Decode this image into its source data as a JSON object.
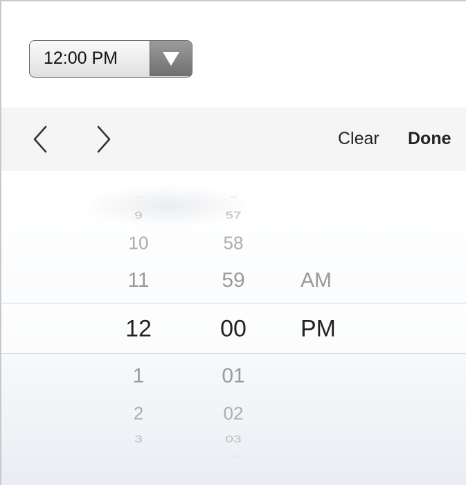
{
  "time_select": {
    "value": "12:00 PM"
  },
  "toolbar": {
    "clear_label": "Clear",
    "done_label": "Done",
    "prev_icon": "chevron-left-icon",
    "next_icon": "chevron-right-icon"
  },
  "picker": {
    "hours": {
      "above": [
        "8",
        "9",
        "10",
        "11"
      ],
      "selected": "12",
      "below": [
        "1",
        "2",
        "3",
        "4"
      ]
    },
    "minutes": {
      "above": [
        "56",
        "57",
        "58",
        "59"
      ],
      "selected": "00",
      "below": [
        "01",
        "02",
        "03",
        "04"
      ]
    },
    "ampm": {
      "above": [
        "AM"
      ],
      "selected": "PM"
    }
  }
}
